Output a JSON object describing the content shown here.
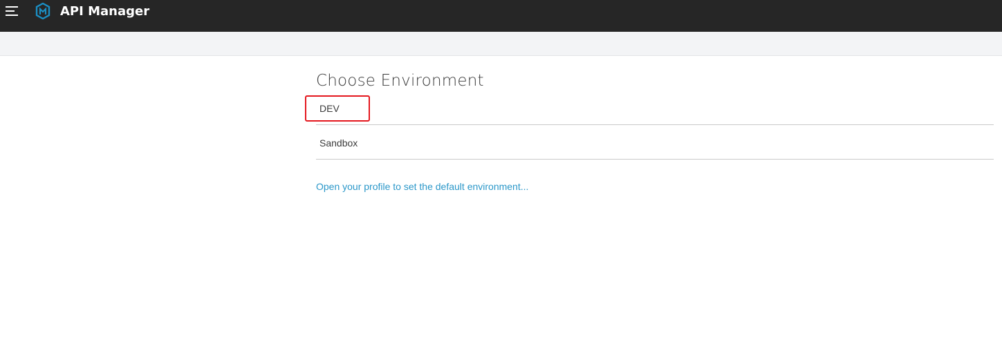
{
  "header": {
    "menu_icon": "hamburger-menu-icon",
    "logo_icon": "mulesoft-logo-icon",
    "title": "API Manager",
    "background": "#262626"
  },
  "main": {
    "title": "Choose Environment",
    "environments": [
      {
        "label": "DEV",
        "highlighted": true
      },
      {
        "label": "Sandbox",
        "highlighted": false
      }
    ],
    "profile_link": "Open your profile to set the default environment..."
  },
  "colors": {
    "link": "#2a97c9",
    "highlight": "#e4161d",
    "subbar": "#f3f4f6"
  }
}
